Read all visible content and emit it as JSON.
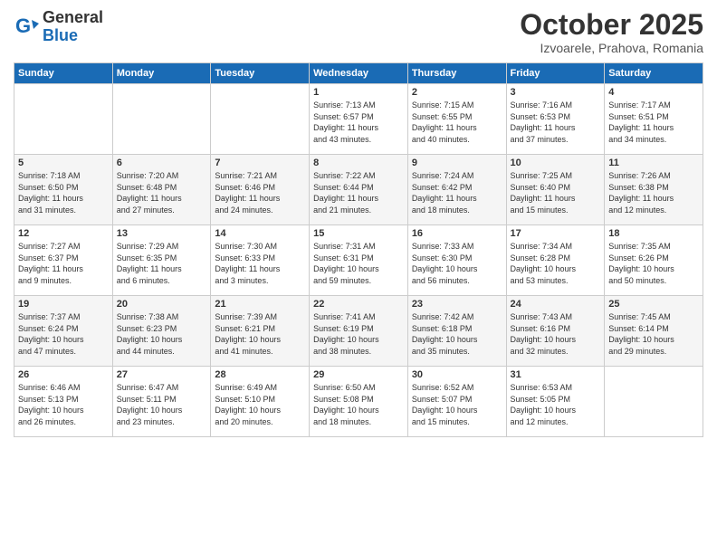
{
  "header": {
    "logo_line1": "General",
    "logo_line2": "Blue",
    "month_title": "October 2025",
    "location": "Izvoarele, Prahova, Romania"
  },
  "weekdays": [
    "Sunday",
    "Monday",
    "Tuesday",
    "Wednesday",
    "Thursday",
    "Friday",
    "Saturday"
  ],
  "weeks": [
    [
      {
        "day": "",
        "info": ""
      },
      {
        "day": "",
        "info": ""
      },
      {
        "day": "",
        "info": ""
      },
      {
        "day": "1",
        "info": "Sunrise: 7:13 AM\nSunset: 6:57 PM\nDaylight: 11 hours\nand 43 minutes."
      },
      {
        "day": "2",
        "info": "Sunrise: 7:15 AM\nSunset: 6:55 PM\nDaylight: 11 hours\nand 40 minutes."
      },
      {
        "day": "3",
        "info": "Sunrise: 7:16 AM\nSunset: 6:53 PM\nDaylight: 11 hours\nand 37 minutes."
      },
      {
        "day": "4",
        "info": "Sunrise: 7:17 AM\nSunset: 6:51 PM\nDaylight: 11 hours\nand 34 minutes."
      }
    ],
    [
      {
        "day": "5",
        "info": "Sunrise: 7:18 AM\nSunset: 6:50 PM\nDaylight: 11 hours\nand 31 minutes."
      },
      {
        "day": "6",
        "info": "Sunrise: 7:20 AM\nSunset: 6:48 PM\nDaylight: 11 hours\nand 27 minutes."
      },
      {
        "day": "7",
        "info": "Sunrise: 7:21 AM\nSunset: 6:46 PM\nDaylight: 11 hours\nand 24 minutes."
      },
      {
        "day": "8",
        "info": "Sunrise: 7:22 AM\nSunset: 6:44 PM\nDaylight: 11 hours\nand 21 minutes."
      },
      {
        "day": "9",
        "info": "Sunrise: 7:24 AM\nSunset: 6:42 PM\nDaylight: 11 hours\nand 18 minutes."
      },
      {
        "day": "10",
        "info": "Sunrise: 7:25 AM\nSunset: 6:40 PM\nDaylight: 11 hours\nand 15 minutes."
      },
      {
        "day": "11",
        "info": "Sunrise: 7:26 AM\nSunset: 6:38 PM\nDaylight: 11 hours\nand 12 minutes."
      }
    ],
    [
      {
        "day": "12",
        "info": "Sunrise: 7:27 AM\nSunset: 6:37 PM\nDaylight: 11 hours\nand 9 minutes."
      },
      {
        "day": "13",
        "info": "Sunrise: 7:29 AM\nSunset: 6:35 PM\nDaylight: 11 hours\nand 6 minutes."
      },
      {
        "day": "14",
        "info": "Sunrise: 7:30 AM\nSunset: 6:33 PM\nDaylight: 11 hours\nand 3 minutes."
      },
      {
        "day": "15",
        "info": "Sunrise: 7:31 AM\nSunset: 6:31 PM\nDaylight: 10 hours\nand 59 minutes."
      },
      {
        "day": "16",
        "info": "Sunrise: 7:33 AM\nSunset: 6:30 PM\nDaylight: 10 hours\nand 56 minutes."
      },
      {
        "day": "17",
        "info": "Sunrise: 7:34 AM\nSunset: 6:28 PM\nDaylight: 10 hours\nand 53 minutes."
      },
      {
        "day": "18",
        "info": "Sunrise: 7:35 AM\nSunset: 6:26 PM\nDaylight: 10 hours\nand 50 minutes."
      }
    ],
    [
      {
        "day": "19",
        "info": "Sunrise: 7:37 AM\nSunset: 6:24 PM\nDaylight: 10 hours\nand 47 minutes."
      },
      {
        "day": "20",
        "info": "Sunrise: 7:38 AM\nSunset: 6:23 PM\nDaylight: 10 hours\nand 44 minutes."
      },
      {
        "day": "21",
        "info": "Sunrise: 7:39 AM\nSunset: 6:21 PM\nDaylight: 10 hours\nand 41 minutes."
      },
      {
        "day": "22",
        "info": "Sunrise: 7:41 AM\nSunset: 6:19 PM\nDaylight: 10 hours\nand 38 minutes."
      },
      {
        "day": "23",
        "info": "Sunrise: 7:42 AM\nSunset: 6:18 PM\nDaylight: 10 hours\nand 35 minutes."
      },
      {
        "day": "24",
        "info": "Sunrise: 7:43 AM\nSunset: 6:16 PM\nDaylight: 10 hours\nand 32 minutes."
      },
      {
        "day": "25",
        "info": "Sunrise: 7:45 AM\nSunset: 6:14 PM\nDaylight: 10 hours\nand 29 minutes."
      }
    ],
    [
      {
        "day": "26",
        "info": "Sunrise: 6:46 AM\nSunset: 5:13 PM\nDaylight: 10 hours\nand 26 minutes."
      },
      {
        "day": "27",
        "info": "Sunrise: 6:47 AM\nSunset: 5:11 PM\nDaylight: 10 hours\nand 23 minutes."
      },
      {
        "day": "28",
        "info": "Sunrise: 6:49 AM\nSunset: 5:10 PM\nDaylight: 10 hours\nand 20 minutes."
      },
      {
        "day": "29",
        "info": "Sunrise: 6:50 AM\nSunset: 5:08 PM\nDaylight: 10 hours\nand 18 minutes."
      },
      {
        "day": "30",
        "info": "Sunrise: 6:52 AM\nSunset: 5:07 PM\nDaylight: 10 hours\nand 15 minutes."
      },
      {
        "day": "31",
        "info": "Sunrise: 6:53 AM\nSunset: 5:05 PM\nDaylight: 10 hours\nand 12 minutes."
      },
      {
        "day": "",
        "info": ""
      }
    ]
  ]
}
